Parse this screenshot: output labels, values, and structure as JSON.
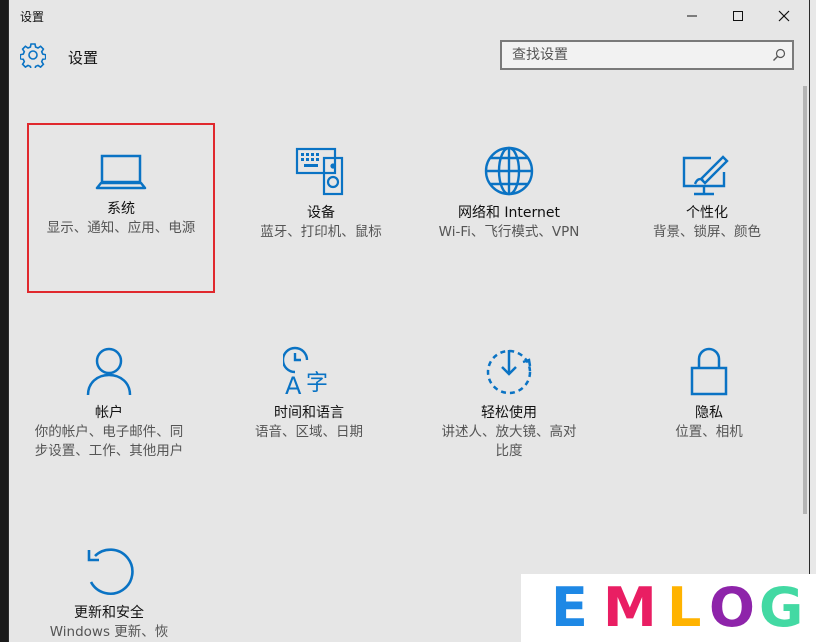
{
  "window": {
    "title": "设置",
    "controls": [
      "minimize-icon",
      "maximize-icon",
      "close-icon"
    ]
  },
  "header": {
    "title": "设置",
    "icon": "gear-icon",
    "search_placeholder": "查找设置"
  },
  "tiles": [
    {
      "name": "系统",
      "desc": "显示、通知、应用、电源",
      "icon": "laptop-icon"
    },
    {
      "name": "设备",
      "desc": "蓝牙、打印机、鼠标",
      "icon": "devices-icon"
    },
    {
      "name": "网络和 Internet",
      "desc": "Wi-Fi、飞行模式、VPN",
      "icon": "globe-icon"
    },
    {
      "name": "个性化",
      "desc": "背景、锁屏、颜色",
      "icon": "personalize-icon"
    },
    {
      "name": "帐户",
      "desc": "你的帐户、电子邮件、同步设置、工作、其他用户",
      "icon": "person-icon"
    },
    {
      "name": "时间和语言",
      "desc": "语音、区域、日期",
      "icon": "time-language-icon"
    },
    {
      "name": "轻松使用",
      "desc": "讲述人、放大镜、高对比度",
      "icon": "ease-of-access-icon"
    },
    {
      "name": "隐私",
      "desc": "位置、相机",
      "icon": "lock-icon"
    },
    {
      "name": "更新和安全",
      "desc": "Windows 更新、恢",
      "icon": "update-icon"
    }
  ],
  "colors": {
    "accent": "#0a73c4",
    "highlight": "#e0282d",
    "background": "#e6e6e6"
  },
  "watermark": {
    "text": "EMLOG",
    "letters": [
      {
        "ch": "E",
        "color": "#1e88e5"
      },
      {
        "ch": "M",
        "color": "#e91e63"
      },
      {
        "ch": "L",
        "color": "#ffb300"
      },
      {
        "ch": "O",
        "color": "#8e24aa"
      },
      {
        "ch": "G",
        "color": "#43d9a3"
      }
    ]
  }
}
